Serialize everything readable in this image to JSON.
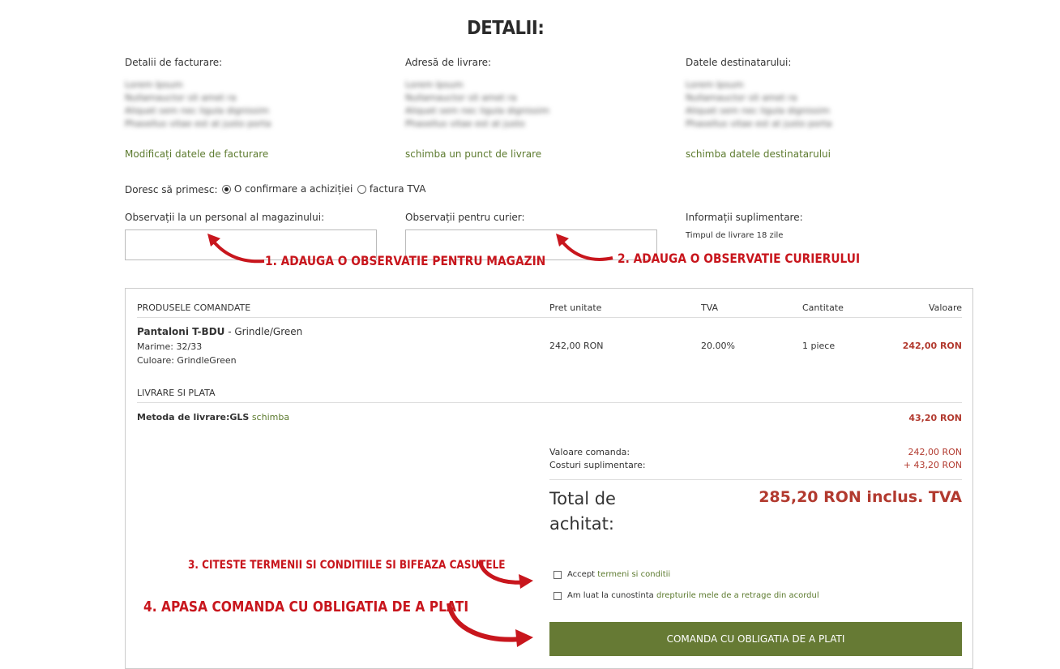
{
  "header": {
    "title": "DETALII:"
  },
  "billing": {
    "heading": "Detalii de facturare:",
    "blurred_lines": [
      "Lorem Ipsum",
      "Nullamauctor sit amet ra",
      "Aliquet sem nec ligula dignissim",
      "Phasellus vitae est at justo porta"
    ],
    "link": "Modificați datele de facturare"
  },
  "shipping": {
    "heading": "Adresă de livrare:",
    "blurred_lines": [
      "Lorem Ipsum",
      "Nullamauctor sit amet ra",
      "Aliquet sem nec ligula dignissim",
      "Phasellus vitae est at justo"
    ],
    "link": "schimba un punct de livrare"
  },
  "recipient": {
    "heading": "Datele destinatarului:",
    "blurred_lines": [
      "Lorem Ipsum",
      "Nullamauctor sit amet ra",
      "Aliquet sem nec ligula dignissim",
      "Phasellus vitae est at justo porta"
    ],
    "link": "schimba datele destinatarului"
  },
  "receive": {
    "label": "Doresc să primesc:",
    "option1": "O confirmare a achiziției",
    "option2": "factura TVA",
    "selected": "option1"
  },
  "notes": {
    "store_label": "Observații la un personal al magazinului:",
    "courier_label": "Observații pentru curier:",
    "extra_label": "Informații suplimentare:",
    "extra_text": "Timpul de livrare 18 zile",
    "store_value": "",
    "courier_value": ""
  },
  "annotations": {
    "a1": "1. ADAUGA O OBSERVATIE PENTRU MAGAZIN",
    "a2": "2. ADAUGA O OBSERVATIE CURIERULUI",
    "a3": "3. CITESTE TERMENII SI CONDITIILE SI BIFEAZA CASUTELE",
    "a4": "4. APASA COMANDA CU OBLIGATIA DE A PLATI"
  },
  "order": {
    "col_products": "PRODUSELE COMANDATE",
    "col_price": "Pret unitate",
    "col_vat": "TVA",
    "col_qty": "Cantitate",
    "col_value": "Valoare",
    "item": {
      "name": "Pantaloni T-BDU",
      "variant": " - Grindle/Green",
      "size": "Marime: 32/33",
      "color": "Culoare: GrindleGreen",
      "price": "242,00 RON",
      "vat": "20.00%",
      "qty": "1 piece",
      "value": "242,00 RON"
    },
    "shipping_heading": "LIVRARE SI PLATA",
    "shipping_method_label": "Metoda de livrare:",
    "shipping_method": "GLS",
    "shipping_change": "schimba",
    "shipping_cost": "43,20 RON",
    "summary_order_label": "Valoare comanda:",
    "summary_order_value": "242,00 RON",
    "summary_extra_label": "Costuri suplimentare:",
    "summary_extra_value": "+ 43,20 RON",
    "total_label_1": "Total de",
    "total_label_2": "achitat:",
    "total_value": "285,20 RON inclus. TVA"
  },
  "terms": {
    "accept_prefix": "Accept ",
    "accept_link": "termeni si conditii",
    "withdraw_prefix": "Am luat la cunostinta ",
    "withdraw_link": "drepturile mele de a retrage din acordul"
  },
  "submit": {
    "label": "COMANDA CU OBLIGATIA DE A PLATI"
  },
  "colors": {
    "accent": "#667a34",
    "link": "#5c7a2e",
    "price": "#b23a2f",
    "annotation": "#c8161d"
  }
}
